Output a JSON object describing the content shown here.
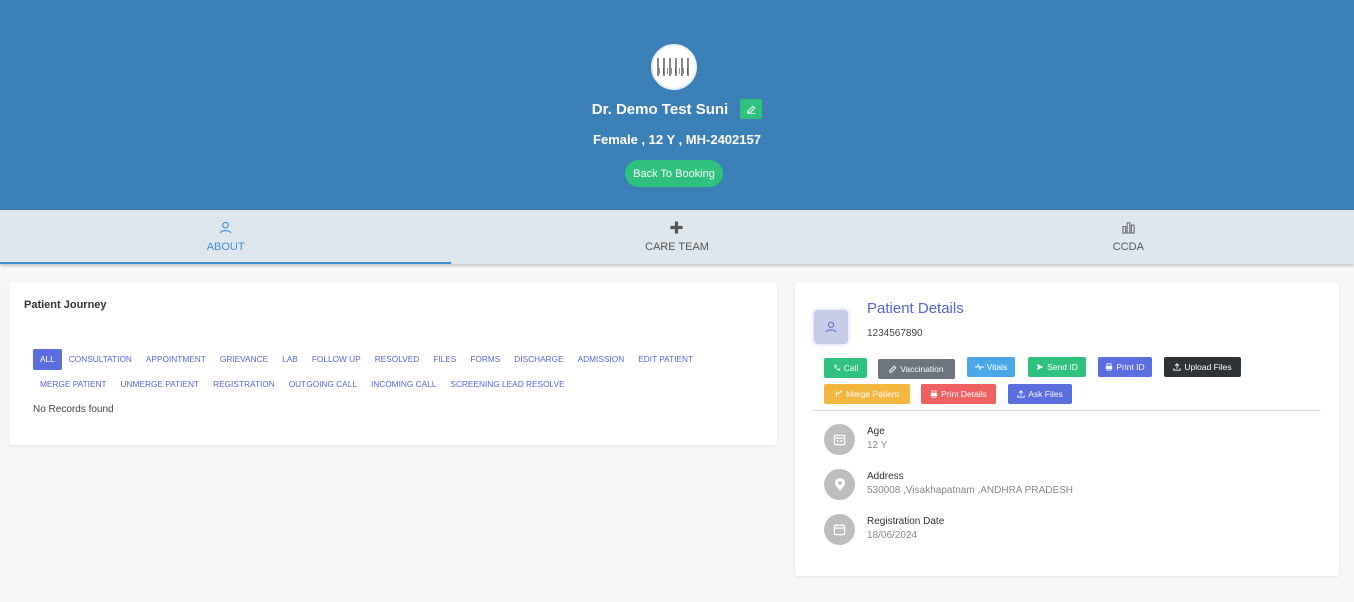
{
  "header": {
    "doctor_name": "Dr. Demo Test Suni",
    "subtitle": "Female , 12 Y , MH-2402157",
    "back_button": "Back To Booking"
  },
  "tabs": [
    {
      "label": "ABOUT",
      "icon": "user-icon",
      "active": true
    },
    {
      "label": "CARE TEAM",
      "icon": "plus-icon",
      "active": false
    },
    {
      "label": "CCDA",
      "icon": "chart-icon",
      "active": false
    }
  ],
  "journey": {
    "title": "Patient Journey",
    "filters": [
      "ALL",
      "CONSULTATION",
      "APPOINTMENT",
      "GRIEVANCE",
      "LAB",
      "FOLLOW UP",
      "RESOLVED",
      "FILES",
      "FORMS",
      "DISCHARGE",
      "ADMISSION",
      "EDIT PATIENT",
      "MERGE PATIENT",
      "UNMERGE PATIENT",
      "REGISTRATION",
      "OUTGOING CALL",
      "INCOMING CALL",
      "SCREENING LEAD RESOLVE"
    ],
    "empty_text": "No Records found"
  },
  "details": {
    "title": "Patient Details",
    "phone": "1234567890",
    "actions": [
      {
        "label": "Call",
        "icon": "phone-icon",
        "color": "#2ec27e"
      },
      {
        "label": "Vaccination",
        "icon": "pencil-icon",
        "color": "#6c757d"
      },
      {
        "label": "Vitals",
        "icon": "pulse-icon",
        "color": "#4aa8e8"
      },
      {
        "label": "Send ID",
        "icon": "send-icon",
        "color": "#2ec27e"
      },
      {
        "label": "Print ID",
        "icon": "printer-icon",
        "color": "#5a6ee0"
      },
      {
        "label": "Upload Files",
        "icon": "upload-icon",
        "color": "#2f3338"
      },
      {
        "label": "Merge Patient",
        "icon": "merge-icon",
        "color": "#f3b63f"
      },
      {
        "label": "Print Details",
        "icon": "printer-icon",
        "color": "#ef6060"
      },
      {
        "label": "Ask Files",
        "icon": "upload-icon",
        "color": "#5a6ee0"
      }
    ],
    "info": [
      {
        "label": "Age",
        "value": "12 Y",
        "icon": "calendar-icon"
      },
      {
        "label": "Address",
        "value": "530008 ,Visakhapatnam ,ANDHRA PRADESH",
        "icon": "location-pin-icon"
      },
      {
        "label": "Registration Date",
        "value": "18/06/2024",
        "icon": "calendar-icon"
      }
    ]
  }
}
